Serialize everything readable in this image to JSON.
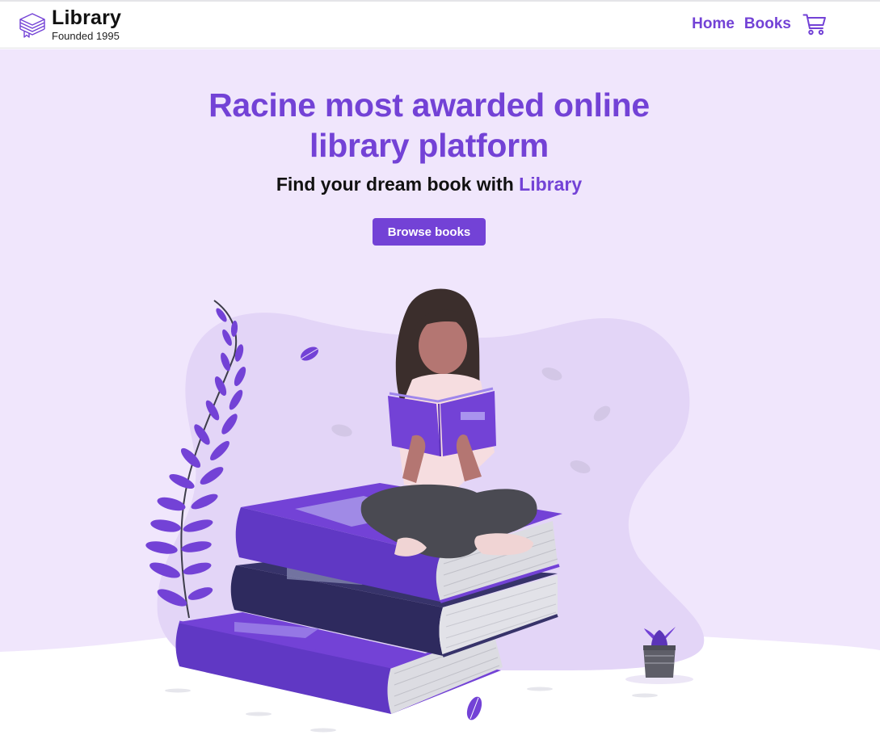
{
  "brand": {
    "title": "Library",
    "subtitle": "Founded 1995",
    "icon": "book-stack-icon"
  },
  "nav": {
    "items": [
      {
        "label": "Home"
      },
      {
        "label": "Books"
      }
    ],
    "cart_icon": "shopping-cart-icon"
  },
  "hero": {
    "title_line1": "Racine most awarded online",
    "title_line2": "library platform",
    "subtitle_prefix": "Find your dream book with",
    "subtitle_accent": "Library",
    "cta_label": "Browse books",
    "illustration": "woman-reading-on-books-illustration"
  },
  "colors": {
    "accent": "#7342d6",
    "hero_bg": "#f0e6fc",
    "blob": "#e3d5f7"
  }
}
